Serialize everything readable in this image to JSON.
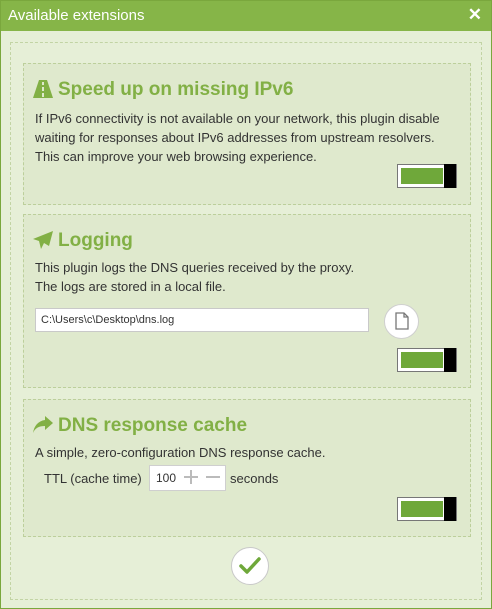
{
  "window": {
    "title": "Available extensions"
  },
  "extensions": [
    {
      "icon": "road-icon",
      "title": "Speed up on missing IPv6",
      "description": "If IPv6 connectivity is not available on your network, this plugin disable waiting for responses about IPv6 addresses from upstream resolvers. This can improve your web browsing experience.",
      "enabled": true
    },
    {
      "icon": "paper-plane-icon",
      "title": "Logging",
      "description_line1": "This plugin logs the DNS queries received by the proxy.",
      "description_line2": "The logs are stored in a local file.",
      "log_path": "C:\\Users\\c\\Desktop\\dns.log",
      "enabled": true
    },
    {
      "icon": "share-arrow-icon",
      "title": "DNS response cache",
      "description": "A simple, zero-configuration DNS response cache.",
      "ttl_label": "TTL (cache time)",
      "ttl_value": "100",
      "ttl_unit": "seconds",
      "enabled": true
    }
  ],
  "colors": {
    "accent": "#82b045",
    "titlebar": "#86b548",
    "toggle_on": "#6fa83a"
  }
}
